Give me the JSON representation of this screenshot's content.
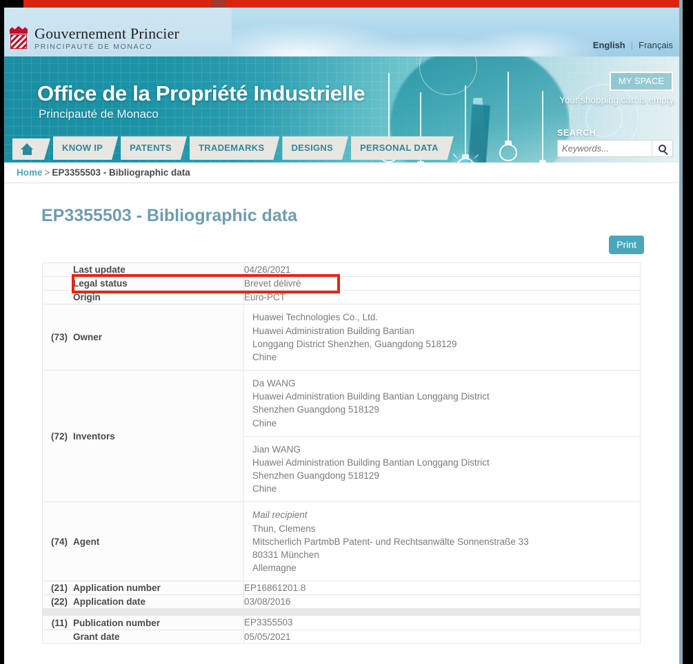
{
  "header": {
    "gov_name": "Gouvernement Princier",
    "gov_subtitle": "PRINCIPAUTÉ DE MONACO",
    "lang_active": "English",
    "lang_other": "Français",
    "lang_separator": "|",
    "site_title": "Office de la Propriété Industrielle",
    "site_subtitle": "Principauté de Monaco",
    "my_space": "MY SPACE",
    "cart_message": "Your shopping cart is empty."
  },
  "nav": {
    "items": [
      {
        "label": "KNOW IP"
      },
      {
        "label": "PATENTS"
      },
      {
        "label": "TRADEMARKS"
      },
      {
        "label": "DESIGNS"
      },
      {
        "label": "PERSONAL DATA"
      }
    ]
  },
  "search": {
    "label": "SEARCH",
    "placeholder": "Keywords...",
    "value": ""
  },
  "breadcrumb": {
    "home": "Home",
    "separator": ">",
    "current": "EP3355503 - Bibliographic data"
  },
  "page": {
    "title": "EP3355503 - Bibliographic data",
    "print_label": "Print"
  },
  "table": {
    "rows": [
      {
        "code": "",
        "label": "Last update",
        "value": "04/26/2021"
      },
      {
        "code": "",
        "label": "Legal status",
        "value": "Brevet délivré",
        "highlighted": true
      },
      {
        "code": "",
        "label": "Origin",
        "value": "Euro-PCT"
      },
      {
        "code": "(73)",
        "label": "Owner",
        "blocks": [
          [
            "Huawei Technologies Co., Ltd.",
            "Huawei Administration Building Bantian",
            "Longgang District Shenzhen, Guangdong 518129",
            "Chine"
          ]
        ]
      },
      {
        "code": "(72)",
        "label": "Inventors",
        "blocks": [
          [
            "Da WANG",
            "Huawei Administration Building Bantian Longgang District",
            "Shenzhen Guangdong 518129",
            "Chine"
          ],
          [
            "Jian WANG",
            "Huawei Administration Building Bantian Longgang District",
            "Shenzhen Guangdong 518129",
            "Chine"
          ]
        ]
      },
      {
        "code": "(74)",
        "label": "Agent",
        "blocks": [
          [
            "Mail recipient",
            "Thun, Clemens",
            "Mitscherlich PartmbB Patent- und Rechtsanwälte Sonnenstraße 33",
            "80331 München",
            "Allemagne"
          ]
        ],
        "first_line_italic": true
      },
      {
        "code": "(21)",
        "label": "Application number",
        "value": "EP16861201.8"
      },
      {
        "code": "(22)",
        "label": "Application date",
        "value": "03/08/2016"
      },
      {
        "spacer": true
      },
      {
        "code": "(11)",
        "label": "Publication number",
        "value": "EP3355503"
      },
      {
        "code": "",
        "label": "Grant date",
        "value": "05/05/2021"
      }
    ]
  },
  "annotation": {
    "highlight_color": "#ee2211",
    "highlight_target": "Legal status"
  },
  "colors": {
    "red_bar": "#d9250f",
    "teal": "#1b8ea3",
    "accent": "#4aa7bb",
    "title": "#6d9cb3",
    "link": "#49a8bd"
  }
}
